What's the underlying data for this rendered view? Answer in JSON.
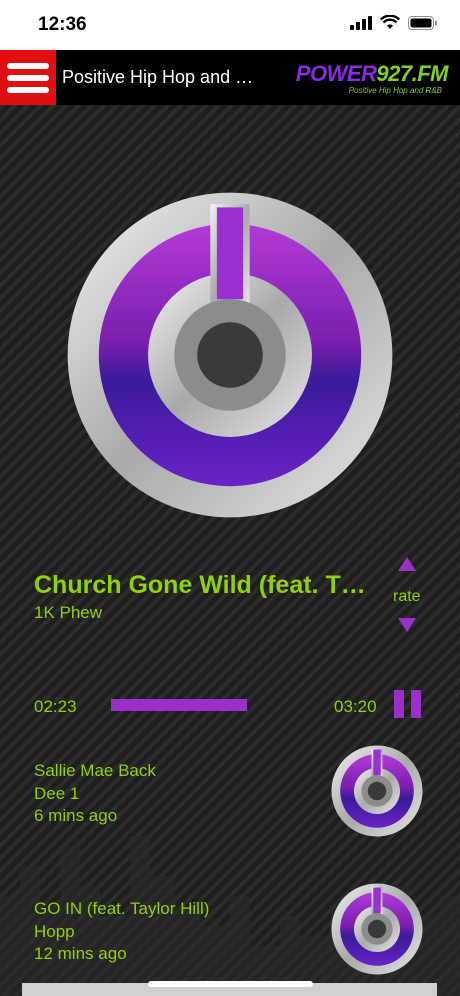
{
  "status": {
    "time": "12:36"
  },
  "header": {
    "title": "Positive Hip Hop and …",
    "logo_prefix": "POWER",
    "logo_number": "927.FM",
    "logo_tagline": "Positive Hip Hop and R&B"
  },
  "now_playing": {
    "title": "Church Gone Wild (feat. T…",
    "artist": "1K Phew",
    "rate_label": "rate",
    "elapsed": "02:23",
    "duration": "03:20",
    "progress": 0.715
  },
  "history": [
    {
      "title": "Sallie Mae Back",
      "artist": "Dee 1",
      "when": "6 mins ago"
    },
    {
      "title": "GO IN (feat. Taylor Hill)",
      "artist": "Hopp",
      "when": "12 mins ago"
    }
  ],
  "colors": {
    "accent_green": "#8fd10a",
    "accent_purple": "#9b30c8",
    "menu_red": "#e01010"
  },
  "icons": {
    "menu": "hamburger-icon",
    "pause": "pause-icon",
    "rate_up": "triangle-up-icon",
    "rate_down": "triangle-down-icon"
  }
}
